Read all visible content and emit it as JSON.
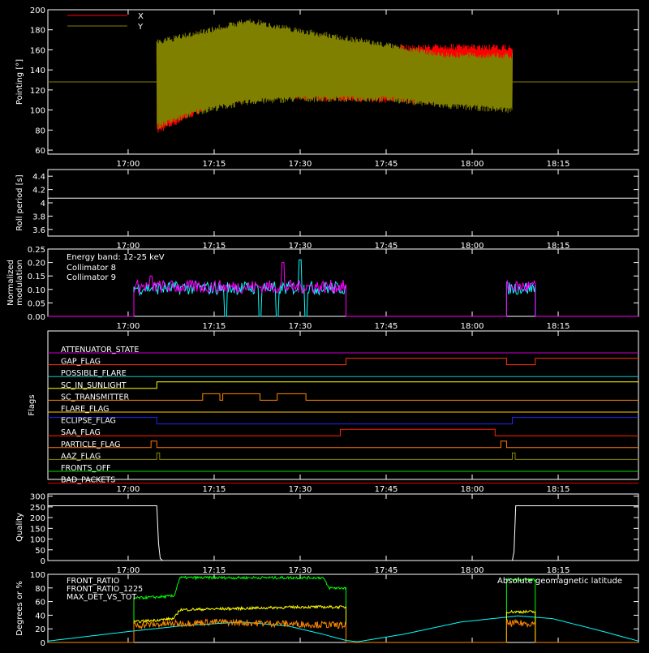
{
  "chart_data": [
    {
      "panel": "pointing",
      "type": "line",
      "ylabel": "Pointing [°]",
      "ylim": [
        56,
        200
      ],
      "yticks": [
        60,
        80,
        100,
        120,
        140,
        160,
        180,
        200
      ],
      "legend": {
        "position": "top-left",
        "entries": [
          {
            "name": "X",
            "color": "#ff0000"
          },
          {
            "name": "Y",
            "color": "#808000"
          }
        ]
      },
      "time_range": [
        "16:46",
        "18:29"
      ],
      "xticks": [
        "17:00",
        "17:15",
        "17:30",
        "17:45",
        "18:00",
        "18:15"
      ],
      "series": [
        {
          "name": "Y-baseline",
          "color": "#808000",
          "constant": 128
        },
        {
          "name": "X",
          "color": "#ff0000",
          "start": "17:05",
          "end": "18:07",
          "envelope_upper": [
            [
              17.08,
              160
            ],
            [
              17.25,
              165
            ],
            [
              17.42,
              170
            ],
            [
              17.58,
              164
            ],
            [
              17.75,
              165
            ],
            [
              17.92,
              166
            ],
            [
              18.1,
              165
            ]
          ],
          "envelope_lower": [
            [
              17.08,
              75
            ],
            [
              17.25,
              103
            ],
            [
              17.42,
              112
            ],
            [
              17.58,
              108
            ],
            [
              17.75,
              107
            ],
            [
              17.92,
              106
            ],
            [
              18.1,
              105
            ]
          ]
        },
        {
          "name": "Y",
          "color": "#808000",
          "start": "17:05",
          "end": "18:07",
          "envelope_upper": [
            [
              17.08,
              170
            ],
            [
              17.2,
              180
            ],
            [
              17.35,
              192
            ],
            [
              17.5,
              182
            ],
            [
              17.75,
              168
            ],
            [
              17.92,
              158
            ],
            [
              18.1,
              157
            ]
          ],
          "envelope_lower": [
            [
              17.08,
              80
            ],
            [
              17.2,
              95
            ],
            [
              17.35,
              105
            ],
            [
              17.5,
              108
            ],
            [
              17.75,
              108
            ],
            [
              17.92,
              101
            ],
            [
              18.1,
              97
            ]
          ]
        }
      ]
    },
    {
      "panel": "roll-period",
      "type": "line",
      "ylabel": "Roll period [s]",
      "ylim": [
        3.5,
        4.5
      ],
      "yticks": [
        3.6,
        3.8,
        4.0,
        4.2,
        4.4
      ],
      "xticks": [
        "17:00",
        "17:15",
        "17:30",
        "17:45",
        "18:00",
        "18:15"
      ],
      "series": [
        {
          "name": "roll period",
          "color": "#ffffff",
          "constant": 4.07
        }
      ]
    },
    {
      "panel": "modulation",
      "type": "line",
      "ylabel_lines": [
        "Normalized",
        "modulation"
      ],
      "ylim": [
        0,
        0.25
      ],
      "yticks": [
        0.0,
        0.05,
        0.1,
        0.15,
        0.2,
        0.25
      ],
      "yticklabels": [
        "0.00",
        "0.05",
        "0.10",
        "0.15",
        "0.20",
        "0.25"
      ],
      "annotation": "Energy band: 12-25 keV",
      "legend": {
        "position": "top-left",
        "entries": [
          {
            "name": "Collimator 8",
            "color": "#00ffff"
          },
          {
            "name": "Collimator 9",
            "color": "#ff00ff"
          }
        ]
      },
      "xticks": [
        "17:00",
        "17:15",
        "17:30",
        "17:45",
        "18:00",
        "18:15"
      ],
      "series": [
        {
          "name": "Collimator 8",
          "color": "#00ffff",
          "active_intervals": [
            [
              "17:01",
              "17:38"
            ],
            [
              "18:06",
              "18:11"
            ]
          ],
          "mean": 0.105,
          "dips_to_zero": [
            "17:17",
            "17:23",
            "17:26",
            "17:31"
          ],
          "spikes": [
            [
              "17:30",
              0.21
            ],
            [
              "17:17",
              0.16
            ]
          ]
        },
        {
          "name": "Collimator 9",
          "color": "#ff00ff",
          "active_intervals": [
            [
              "17:01",
              "17:38"
            ],
            [
              "18:06",
              "18:11"
            ]
          ],
          "mean": 0.11,
          "spikes": [
            [
              "17:27",
              0.2
            ],
            [
              "17:04",
              0.15
            ]
          ]
        }
      ]
    },
    {
      "panel": "flags",
      "type": "line",
      "ylabel": "Flags",
      "xticks": [
        "17:00",
        "17:15",
        "17:30",
        "17:45",
        "18:00",
        "18:15"
      ],
      "series": [
        {
          "name": "ATTENUATOR_STATE",
          "color": "#cc00cc",
          "segments": [
            [
              "16:46",
              "18:29",
              0
            ]
          ]
        },
        {
          "name": "GAP_FLAG",
          "color": "#ff3300",
          "segments": [
            [
              "16:46",
              "17:38",
              0
            ],
            [
              "17:38",
              "18:06",
              1
            ],
            [
              "18:06",
              "18:11",
              0
            ],
            [
              "18:11",
              "18:29",
              1
            ]
          ]
        },
        {
          "name": "POSSIBLE_FLARE",
          "color": "#00cccc",
          "segments": [
            [
              "16:46",
              "18:29",
              0
            ]
          ]
        },
        {
          "name": "SC_IN_SUNLIGHT",
          "color": "#ffff00",
          "segments": [
            [
              "16:46",
              "17:05",
              0
            ],
            [
              "17:05",
              "18:29",
              1
            ]
          ]
        },
        {
          "name": "SC_TRANSMITTER",
          "color": "#ff8800",
          "segments": [
            [
              "16:46",
              "17:13",
              0
            ],
            [
              "17:13",
              "17:16",
              1
            ],
            [
              "17:16",
              "17:16.5",
              0
            ],
            [
              "17:16.5",
              "17:23",
              1
            ],
            [
              "17:23",
              "17:26",
              0
            ],
            [
              "17:26",
              "17:31",
              1
            ],
            [
              "17:31",
              "18:29",
              0
            ]
          ]
        },
        {
          "name": "FLARE_FLAG",
          "color": "#ffcc00",
          "segments": [
            [
              "16:46",
              "18:29",
              0
            ]
          ]
        },
        {
          "name": "ECLIPSE_FLAG",
          "color": "#2222ff",
          "segments": [
            [
              "16:46",
              "17:05",
              1
            ],
            [
              "17:05",
              "18:07",
              0
            ],
            [
              "18:07",
              "18:29",
              1
            ]
          ]
        },
        {
          "name": "SAA_FLAG",
          "color": "#ff2200",
          "segments": [
            [
              "16:46",
              "17:37",
              0
            ],
            [
              "17:37",
              "18:04",
              1
            ],
            [
              "18:04",
              "18:29",
              0
            ]
          ]
        },
        {
          "name": "PARTICLE_FLAG",
          "color": "#ff7700",
          "segments": [
            [
              "16:46",
              "17:04",
              0
            ],
            [
              "17:04",
              "17:05",
              1
            ],
            [
              "17:05",
              "18:05",
              0
            ],
            [
              "18:05",
              "18:06",
              1
            ],
            [
              "18:06",
              "18:29",
              0
            ]
          ]
        },
        {
          "name": "AAZ_FLAG",
          "color": "#888800",
          "segments": [
            [
              "16:46",
              "17:05",
              0
            ],
            [
              "17:05",
              "17:05.5",
              1
            ],
            [
              "17:05.5",
              "18:07",
              0
            ],
            [
              "18:07",
              "18:07.5",
              1
            ],
            [
              "18:07.5",
              "18:29",
              0
            ]
          ]
        },
        {
          "name": "FRONTS_OFF",
          "color": "#00dd00",
          "segments": [
            [
              "16:46",
              "18:29",
              0
            ]
          ]
        },
        {
          "name": "BAD_PACKETS",
          "color": "#ee0000",
          "segments": [
            [
              "16:46",
              "18:29",
              0
            ]
          ]
        }
      ]
    },
    {
      "panel": "quality",
      "type": "line",
      "ylabel": "Quality",
      "ylim": [
        0,
        310
      ],
      "yticks": [
        0,
        50,
        100,
        150,
        200,
        250,
        300
      ],
      "xticks": [
        "17:00",
        "17:15",
        "17:30",
        "17:45",
        "18:00",
        "18:15"
      ],
      "series": [
        {
          "name": "quality",
          "color": "#ffffff",
          "points": [
            [
              "16:46",
              255
            ],
            [
              "17:05",
              255
            ],
            [
              "17:05.3",
              80
            ],
            [
              "17:05.6",
              10
            ],
            [
              "17:06",
              0
            ],
            [
              "18:07",
              0
            ],
            [
              "18:07.3",
              40
            ],
            [
              "18:07.6",
              255
            ],
            [
              "18:29",
              255
            ]
          ]
        }
      ]
    },
    {
      "panel": "ratios",
      "type": "line",
      "ylabel": "Degrees or %",
      "ylim": [
        0,
        100
      ],
      "yticks": [
        0,
        20,
        40,
        60,
        80,
        100
      ],
      "legend": {
        "position": "top-left",
        "entries": [
          {
            "name": "FRONT_RATIO",
            "color": "#ffff00"
          },
          {
            "name": "FRONT_RATIO_1225",
            "color": "#00ff00"
          },
          {
            "name": "MAX_DET_VS_TOT",
            "color": "#ff8800"
          }
        ]
      },
      "annotation": "Absolute geomagnetic latitude",
      "annotation_color": "#00ffff",
      "xticks": [
        "17:00",
        "17:15",
        "17:30",
        "17:45",
        "18:00",
        "18:15"
      ],
      "series": [
        {
          "name": "FRONT_RATIO",
          "color": "#ffff00",
          "points": [
            [
              "17:01",
              30
            ],
            [
              "17:08",
              35
            ],
            [
              "17:09",
              48
            ],
            [
              "17:20",
              50
            ],
            [
              "17:30",
              52
            ],
            [
              "17:38",
              52
            ],
            [
              "18:06",
              45
            ],
            [
              "18:11",
              45
            ]
          ]
        },
        {
          "name": "FRONT_RATIO_1225",
          "color": "#00ff00",
          "points": [
            [
              "17:01",
              65
            ],
            [
              "17:08",
              68
            ],
            [
              "17:09",
              95
            ],
            [
              "17:20",
              95
            ],
            [
              "17:30",
              95
            ],
            [
              "17:34",
              95
            ],
            [
              "17:35",
              80
            ],
            [
              "17:38",
              80
            ],
            [
              "18:06",
              92
            ],
            [
              "18:11",
              92
            ]
          ]
        },
        {
          "name": "MAX_DET_VS_TOT",
          "color": "#ff8800",
          "points": [
            [
              "17:01",
              25
            ],
            [
              "17:15",
              30
            ],
            [
              "17:30",
              27
            ],
            [
              "17:38",
              25
            ],
            [
              "18:06",
              28
            ],
            [
              "18:11",
              28
            ]
          ]
        },
        {
          "name": "Absolute geomagnetic latitude",
          "color": "#00ffff",
          "points": [
            [
              "16:46",
              2
            ],
            [
              "16:52",
              8
            ],
            [
              "17:00",
              16
            ],
            [
              "17:10",
              25
            ],
            [
              "17:20",
              30
            ],
            [
              "17:28",
              24
            ],
            [
              "17:34",
              12
            ],
            [
              "17:38",
              3
            ],
            [
              "17:40",
              1
            ],
            [
              "17:48",
              12
            ],
            [
              "17:58",
              30
            ],
            [
              "18:08",
              39
            ],
            [
              "18:14",
              35
            ],
            [
              "18:22",
              18
            ],
            [
              "18:29",
              2
            ]
          ]
        }
      ]
    }
  ]
}
